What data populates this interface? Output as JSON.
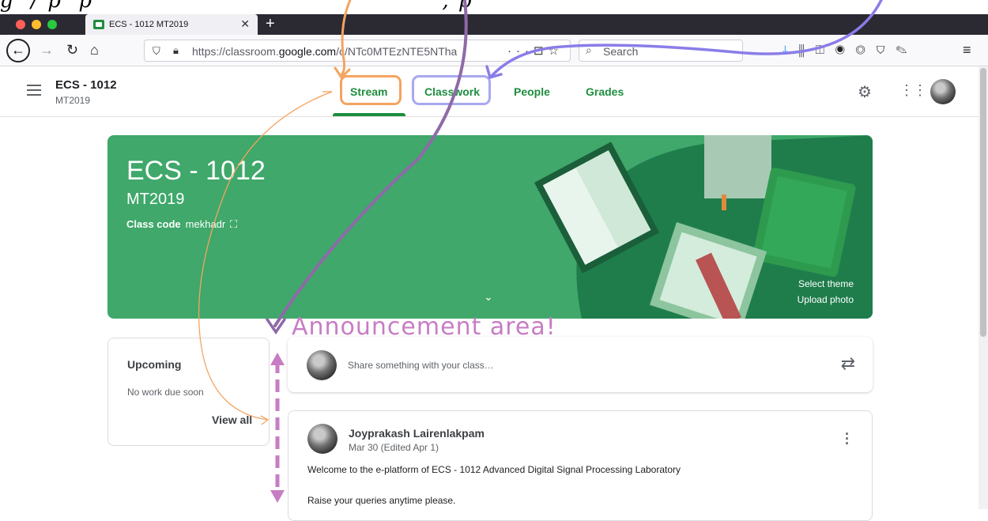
{
  "browser": {
    "tab_title": "ECS - 1012 MT2019",
    "url_prefix": "https://classroom.",
    "url_domain": "google.com",
    "url_path": "/c/NTc0MTEzNTE5NTha",
    "search_placeholder": "Search"
  },
  "header": {
    "class_name": "ECS - 1012",
    "class_section": "MT2019",
    "tabs": [
      "Stream",
      "Classwork",
      "People",
      "Grades"
    ],
    "accent": "#1e8e3e"
  },
  "banner": {
    "title": "ECS - 1012",
    "subtitle": "MT2019",
    "code_label": "Class code",
    "code_value": "mekhadr",
    "select_theme": "Select theme",
    "upload_photo": "Upload photo",
    "color": "#3fa86a"
  },
  "upcoming": {
    "title": "Upcoming",
    "empty": "No work due soon",
    "view_all": "View all"
  },
  "share": {
    "placeholder": "Share something with your class…"
  },
  "post": {
    "author": "Joyprakash Lairenlakpam",
    "date": "Mar 30 (Edited Apr 1)",
    "body1": "Welcome to the e-platform of ECS - 1012 Advanced Digital Signal Processing Laboratory",
    "body2": "Raise your queries anytime please."
  },
  "annotation": {
    "label": "Announcement area!",
    "colors": {
      "orange": "#f4a460",
      "purple": "#c77dc4",
      "blue": "#8a7de8"
    }
  }
}
